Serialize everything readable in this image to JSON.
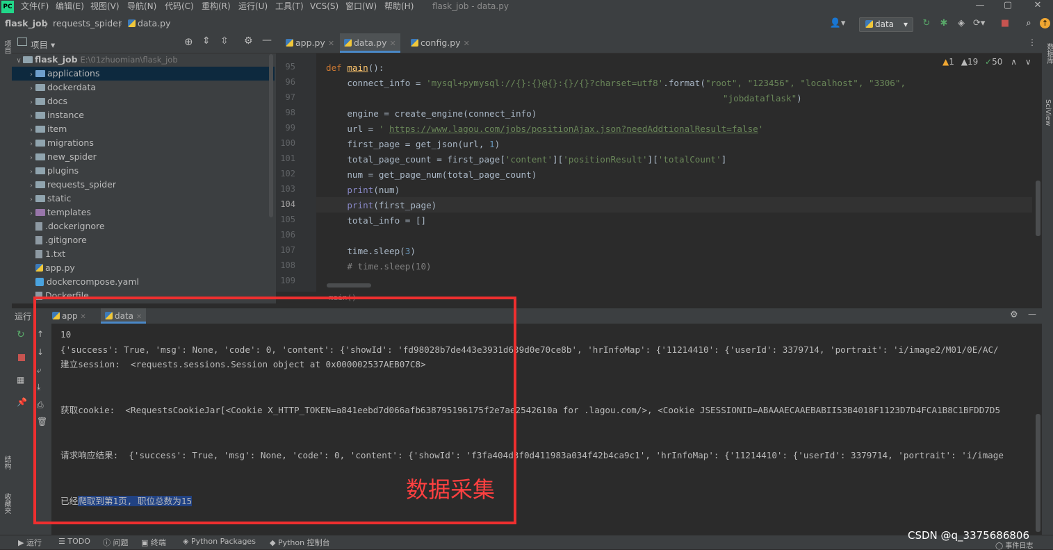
{
  "menubar": {
    "logo": "PC",
    "items": [
      "文件(F)",
      "编辑(E)",
      "视图(V)",
      "导航(N)",
      "代码(C)",
      "重构(R)",
      "运行(U)",
      "工具(T)",
      "VCS(S)",
      "窗口(W)",
      "帮助(H)"
    ],
    "window_title": "flask_job - data.py"
  },
  "breadcrumb": [
    "flask_job",
    "requests_spider",
    "data.py"
  ],
  "run_config": "data",
  "project": {
    "header_label": "项目",
    "root_name": "flask_job",
    "root_path": "E:\\01zhuomian\\flask_job",
    "items": [
      {
        "label": "applications",
        "type": "folder-blue",
        "selected": true
      },
      {
        "label": "dockerdata",
        "type": "folder"
      },
      {
        "label": "docs",
        "type": "folder"
      },
      {
        "label": "instance",
        "type": "folder"
      },
      {
        "label": "item",
        "type": "folder"
      },
      {
        "label": "migrations",
        "type": "folder"
      },
      {
        "label": "new_spider",
        "type": "folder"
      },
      {
        "label": "plugins",
        "type": "folder"
      },
      {
        "label": "requests_spider",
        "type": "folder"
      },
      {
        "label": "static",
        "type": "folder"
      },
      {
        "label": "templates",
        "type": "folder-purple"
      },
      {
        "label": ".dockerignore",
        "type": "file"
      },
      {
        "label": ".gitignore",
        "type": "file"
      },
      {
        "label": "1.txt",
        "type": "file"
      },
      {
        "label": "app.py",
        "type": "py"
      },
      {
        "label": "dockercompose.yaml",
        "type": "yaml"
      },
      {
        "label": "Dockerfile",
        "type": "file"
      }
    ]
  },
  "editor": {
    "tabs": [
      "app.py",
      "data.py",
      "config.py"
    ],
    "active_tab": "data.py",
    "inspections": {
      "warnings": "1",
      "weak_warnings": "19",
      "ok": "50"
    },
    "line_numbers": [
      "95",
      "96",
      "97",
      "98",
      "99",
      "100",
      "101",
      "102",
      "103",
      "104",
      "105",
      "106",
      "107",
      "108",
      "109"
    ],
    "current_line": "104",
    "footer_scope": "main()",
    "code": {
      "l95_kw": "def ",
      "l95_fn": "main",
      "l95_rest": "():",
      "l96_a": "    connect_info = ",
      "l96_s": "'mysql+pymysql://{}:{}@{}:{}/{}?charset=utf8'",
      "l96_b": ".format(",
      "l96_s2": "\"root\", \"123456\", \"localhost\", \"3306\",",
      "l97_s": "\"jobdataflask\"",
      "l97_b": ")",
      "l98": "    engine = create_engine(connect_info)",
      "l99_a": "    url = ",
      "l99_s1": "' ",
      "l99_link": "https://www.lagou.com/jobs/positionAjax.json?needAddtionalResult=false",
      "l99_s2": "'",
      "l100_a": "    first_page = get_json(url, ",
      "l100_n": "1",
      "l100_b": ")",
      "l101_a": "    total_page_count = first_page[",
      "l101_s1": "'content'",
      "l101_b": "][",
      "l101_s2": "'positionResult'",
      "l101_c": "][",
      "l101_s3": "'totalCount'",
      "l101_d": "]",
      "l102": "    num = get_page_num(total_page_count)",
      "l103_bi": "print",
      "l103_rest": "(num)",
      "l104_bi": "print",
      "l104_rest": "(first_page)",
      "l105": "    total_info = []",
      "l107_a": "    time.sleep(",
      "l107_n": "3",
      "l107_b": ")",
      "l108": "    # time.sleep(10)"
    }
  },
  "run_panel": {
    "label": "运行",
    "tabs": [
      "app",
      "data"
    ],
    "active_tab": "data",
    "output": {
      "line1": "10",
      "line2": "{'success': True, 'msg': None, 'code': 0, 'content': {'showId': 'fd98028b7de443e3931d639d0e70ce8b', 'hrInfoMap': {'11214410': {'userId': 3379714, 'portrait': 'i/image2/M01/0E/AC/",
      "line3": "建立session:  <requests.sessions.Session object at 0x000002537AEB07C8>",
      "line4": "获取cookie:  <RequestsCookieJar[<Cookie X_HTTP_TOKEN=a841eebd7d066afb638795196175f2e7ae2542610a for .lagou.com/>, <Cookie JSESSIONID=ABAAAECAAEBABII53B4018F1123D7D4FCA1B8C1BFDD7D5",
      "line5": "请求响应结果:  {'success': True, 'msg': None, 'code': 0, 'content': {'showId': 'f3fa404d3f0d411983a034f42b4ca9c1', 'hrInfoMap': {'11214410': {'userId': 3379714, 'portrait': 'i/image",
      "line6_pre": "已经",
      "line6_hl": "爬取到第1页, 职位总数为15"
    },
    "annotation": "数据采集"
  },
  "bottom_tools": [
    "运行",
    "TODO",
    "问题",
    "终端",
    "Python Packages",
    "Python 控制台"
  ],
  "event_log": "事件日志",
  "right_strip": [
    "数据库",
    "SciView"
  ],
  "left_strip": [
    "项目",
    "结构",
    "收藏夹"
  ],
  "watermark": "CSDN @q_3375686806",
  "colors": {
    "highlight_box": "#ef2f2f",
    "accent": "#4a88c7"
  }
}
